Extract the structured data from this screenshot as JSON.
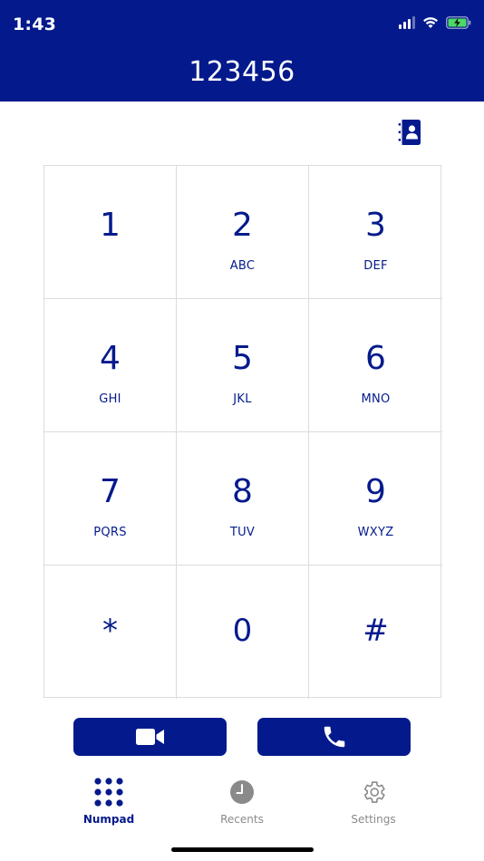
{
  "status_bar": {
    "time": "1:43",
    "icons": [
      "cellular-signal-icon",
      "wifi-icon",
      "battery-charging-icon"
    ]
  },
  "header": {
    "dialed_number": "123456",
    "background_color": "#041a8c"
  },
  "contacts_button": {
    "icon": "contact-book-icon"
  },
  "keypad": {
    "keys": [
      {
        "digit": "1",
        "letters": ""
      },
      {
        "digit": "2",
        "letters": "ABC"
      },
      {
        "digit": "3",
        "letters": "DEF"
      },
      {
        "digit": "4",
        "letters": "GHI"
      },
      {
        "digit": "5",
        "letters": "JKL"
      },
      {
        "digit": "6",
        "letters": "MNO"
      },
      {
        "digit": "7",
        "letters": "PQRS"
      },
      {
        "digit": "8",
        "letters": "TUV"
      },
      {
        "digit": "9",
        "letters": "WXYZ"
      },
      {
        "digit": "*",
        "letters": ""
      },
      {
        "digit": "0",
        "letters": ""
      },
      {
        "digit": "#",
        "letters": ""
      }
    ],
    "text_color": "#041a8c"
  },
  "actions": {
    "video_icon": "video-camera-icon",
    "call_icon": "phone-icon",
    "button_color": "#041a8c"
  },
  "tabs": [
    {
      "label": "Numpad",
      "icon": "numpad-icon",
      "active": true
    },
    {
      "label": "Recents",
      "icon": "clock-icon",
      "active": false
    },
    {
      "label": "Settings",
      "icon": "gear-icon",
      "active": false
    }
  ]
}
